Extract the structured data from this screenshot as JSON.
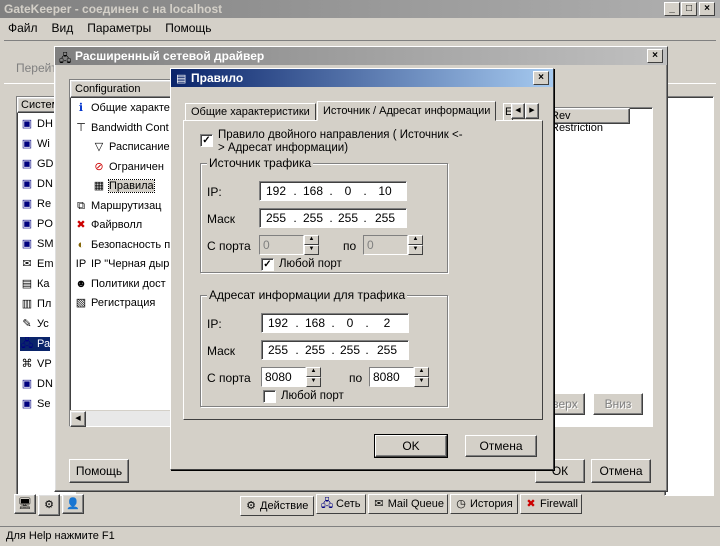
{
  "main_window": {
    "title": "GateKeeper - соединен с на localhost"
  },
  "menu": [
    "Файл",
    "Вид",
    "Параметры",
    "Помощь"
  ],
  "toolbar": {
    "back_label": "Перейт"
  },
  "left_list": {
    "header": "Систем",
    "items": [
      {
        "label": "DH",
        "icon": "server-icon"
      },
      {
        "label": "Wi",
        "icon": "server-icon"
      },
      {
        "label": "GD",
        "icon": "server-icon"
      },
      {
        "label": "DN",
        "icon": "server-icon"
      },
      {
        "label": "Re",
        "icon": "server-icon"
      },
      {
        "label": "PO",
        "icon": "server-icon"
      },
      {
        "label": "SM",
        "icon": "server-icon"
      },
      {
        "label": "Em",
        "icon": "mail-icon"
      },
      {
        "label": "Ка",
        "icon": "cache-icon"
      },
      {
        "label": "Пл",
        "icon": "plugin-icon"
      },
      {
        "label": "Ус",
        "icon": "wrench-icon"
      },
      {
        "label": "Ра",
        "icon": "network-icon"
      },
      {
        "label": "VP",
        "icon": "vpn-icon"
      },
      {
        "label": "DN",
        "icon": "server-icon"
      },
      {
        "label": "Se",
        "icon": "server-icon"
      }
    ]
  },
  "driver_window": {
    "title": "Расширенный сетевой драйвер",
    "tree_header": "Configuration",
    "tree": [
      {
        "label": "Общие характе",
        "icon": "info-icon"
      },
      {
        "label": "Bandwidth Cont",
        "icon": "bandwidth-icon"
      },
      {
        "label": "Расписание",
        "icon": "filter-icon"
      },
      {
        "label": "Ограничен",
        "icon": "restrict-icon"
      },
      {
        "label": "Правила",
        "icon": "rules-icon"
      },
      {
        "label": "Маршрутизац",
        "icon": "route-icon"
      },
      {
        "label": "Файрволл",
        "icon": "firewall-icon"
      },
      {
        "label": "Безопасность п",
        "icon": "security-icon"
      },
      {
        "label": "IP \"Черная дыр",
        "icon": "ip-icon"
      },
      {
        "label": "Политики дост",
        "icon": "policy-icon"
      },
      {
        "label": "Регистрация",
        "icon": "log-icon"
      }
    ],
    "column_header": "Rev Restriction",
    "up_label": "верх",
    "down_label": "Вниз",
    "help_label": "Помощь",
    "ok_label": "ОК",
    "cancel_label": "Отмена"
  },
  "rule_dialog": {
    "title": "Правило",
    "tabs": [
      "Общие характеристики",
      "Источник / Адресат информации",
      "Е"
    ],
    "bidirectional_label": "Правило двойного направления ( Источник <-> Адресат информации)",
    "bidirectional_checked": true,
    "source": {
      "group_title": "Источник трафика",
      "ip_label": "IP:",
      "ip": [
        "192",
        "168",
        "0",
        "10"
      ],
      "mask_label": "Маск",
      "mask": [
        "255",
        "255",
        "255",
        "255"
      ],
      "port_from_label": "С порта",
      "port_from": "0",
      "port_to_label": "по",
      "port_to": "0",
      "any_port_label": "Любой порт",
      "any_port_checked": true
    },
    "dest": {
      "group_title": "Адресат информации для трафика",
      "ip_label": "IP:",
      "ip": [
        "192",
        "168",
        "0",
        "2"
      ],
      "mask_label": "Маск",
      "mask": [
        "255",
        "255",
        "255",
        "255"
      ],
      "port_from_label": "С порта",
      "port_from": "8080",
      "port_to_label": "по",
      "port_to": "8080",
      "any_port_label": "Любой порт",
      "any_port_checked": false
    },
    "ok_label": "OK",
    "cancel_label": "Отмена"
  },
  "bottom_tabs": [
    {
      "label": "Действие",
      "icon": "action-icon"
    },
    {
      "label": "Сеть",
      "icon": "network-icon"
    },
    {
      "label": "Mail Queue",
      "icon": "mail-icon"
    },
    {
      "label": "История",
      "icon": "clock-icon"
    },
    {
      "label": "Firewall",
      "icon": "firewall-icon"
    }
  ],
  "status_bar": "Для Help нажмите F1"
}
